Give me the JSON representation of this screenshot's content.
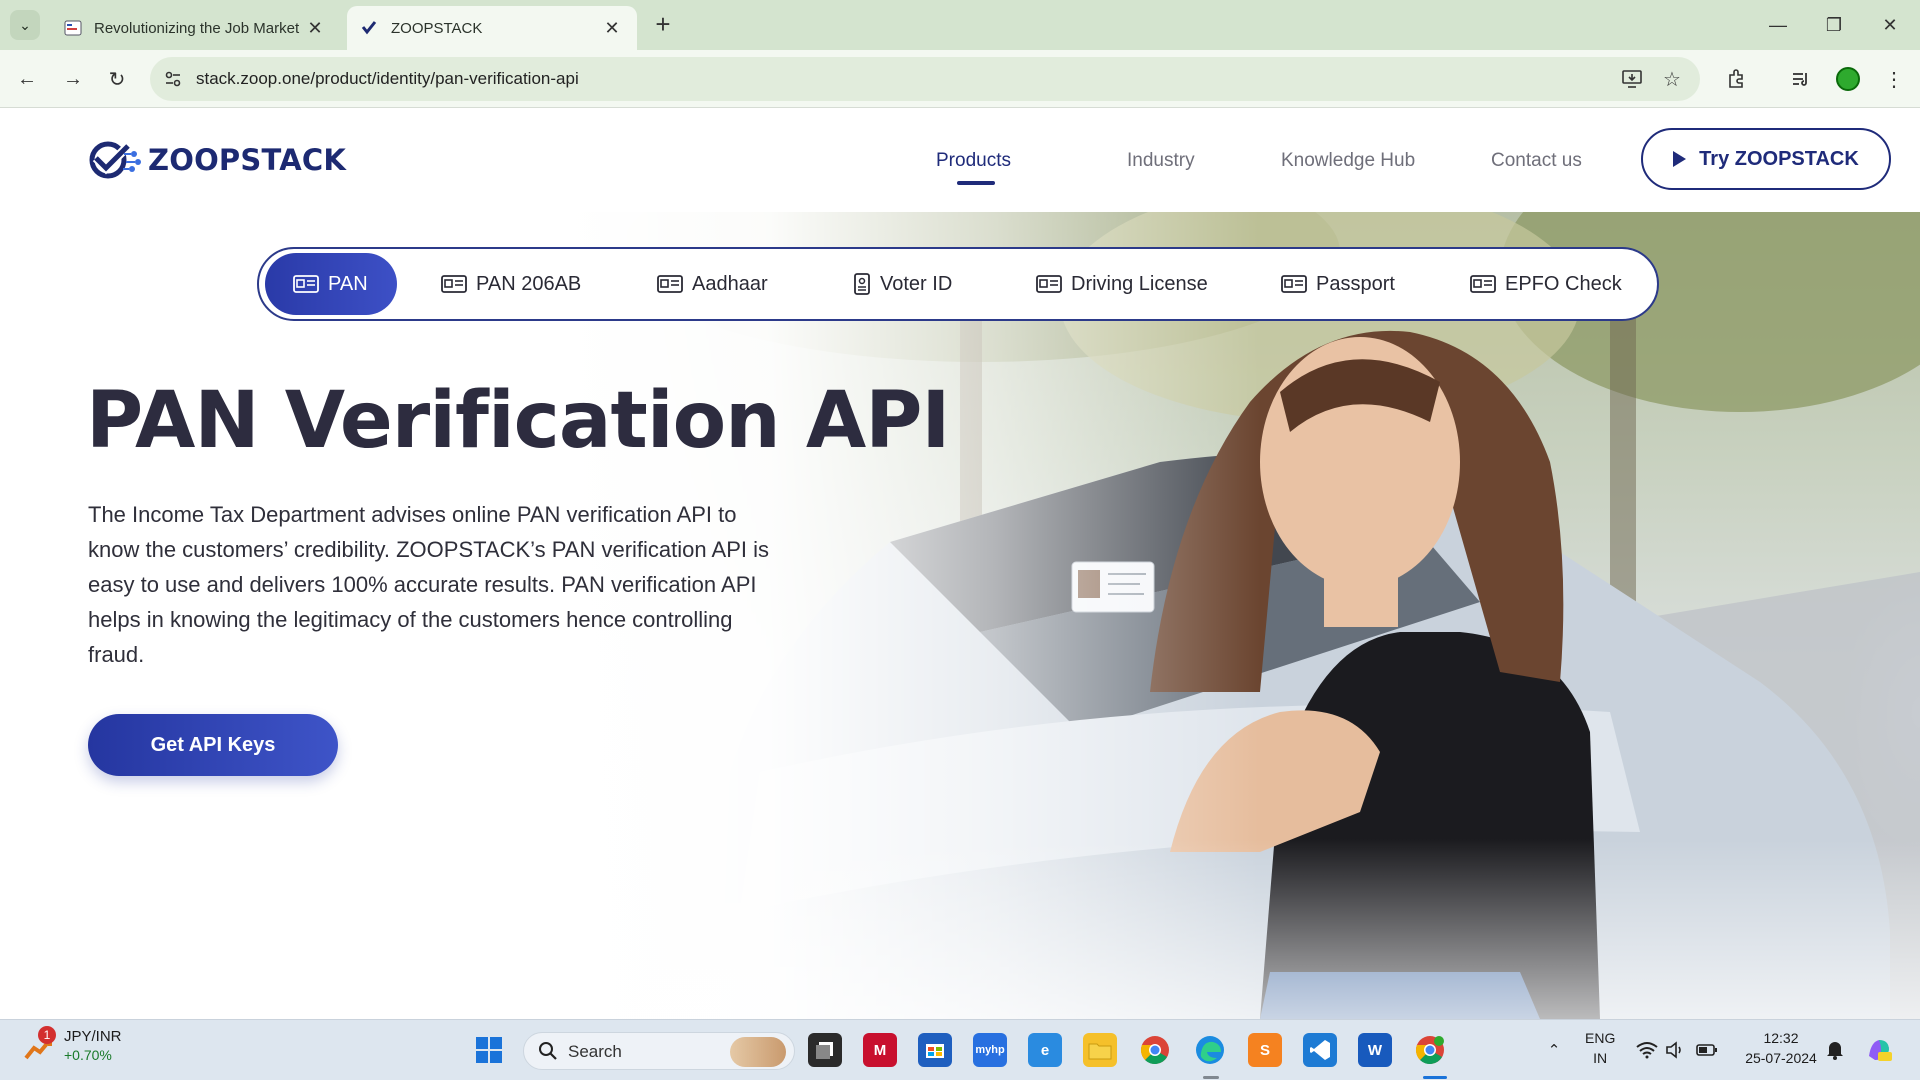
{
  "browser": {
    "tabs": [
      {
        "title": "Revolutionizing the Job Market",
        "active": false
      },
      {
        "title": "ZOOPSTACK",
        "active": true
      }
    ],
    "url": "stack.zoop.one/product/identity/pan-verification-api"
  },
  "site": {
    "brand": "ZOOPSTACK",
    "nav": [
      "Products",
      "Industry",
      "Knowledge Hub",
      "Contact us"
    ],
    "active_nav": "Products",
    "cta_top": "Try ZOOPSTACK",
    "doc_tabs": [
      "PAN",
      "PAN 206AB",
      "Aadhaar",
      "Voter ID",
      "Driving License",
      "Passport",
      "EPFO Check"
    ],
    "active_doc_tab": "PAN",
    "hero": {
      "title": "PAN Verification API",
      "description": "The Income Tax Department advises online PAN verification API to know the customers’ credibility. ZOOPSTACK’s PAN verification API is easy to use and delivers 100% accurate results. PAN verification API helps in knowing the legitimacy of the customers hence controlling fraud.",
      "button": "Get API Keys"
    }
  },
  "taskbar": {
    "ticker": {
      "pair": "JPY/INR",
      "change": "+0.70%",
      "badge": "1"
    },
    "search_label": "Search",
    "lang": [
      "ENG",
      "IN"
    ],
    "time": "12:32",
    "date": "25-07-2024"
  },
  "colors": {
    "brand": "#1f2b7a",
    "accent": "#3040b8"
  }
}
